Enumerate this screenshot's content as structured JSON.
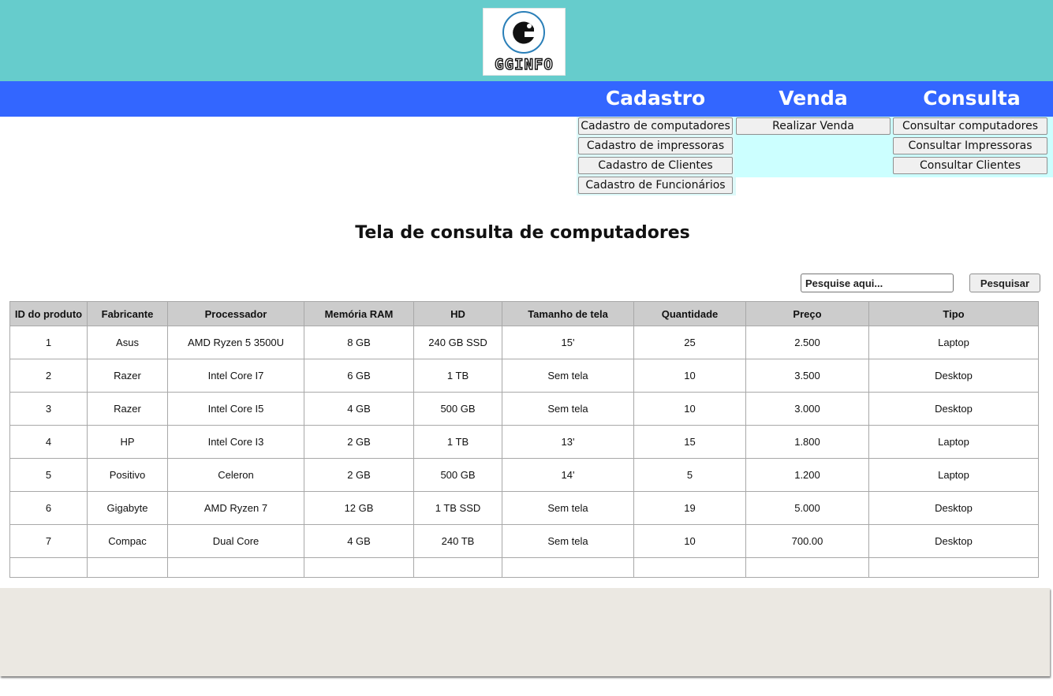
{
  "header": {
    "logo_text": "GGINFO",
    "bg_color": "#66cccc"
  },
  "nav": {
    "bg_color": "#3366ff",
    "menus": [
      {
        "title": "Cadastro",
        "items": [
          "Cadastro de computadores",
          "Cadastro de impressoras",
          "Cadastro de Clientes",
          "Cadastro de Funcionários"
        ]
      },
      {
        "title": "Venda",
        "items": [
          "Realizar Venda"
        ]
      },
      {
        "title": "Consulta",
        "items": [
          "Consultar computadores",
          "Consultar Impressoras",
          "Consultar Clientes"
        ]
      }
    ]
  },
  "page": {
    "title": "Tela de consulta de computadores"
  },
  "search": {
    "placeholder": "Pesquise aqui...",
    "value": "",
    "button_label": "Pesquisar"
  },
  "table": {
    "columns": [
      "ID do produto",
      "Fabricante",
      "Processador",
      "Memória RAM",
      "HD",
      "Tamanho de tela",
      "Quantidade",
      "Preço",
      "Tipo"
    ],
    "rows": [
      [
        "1",
        "Asus",
        "AMD Ryzen 5 3500U",
        "8 GB",
        "240 GB SSD",
        "15'",
        "25",
        "2.500",
        "Laptop"
      ],
      [
        "2",
        "Razer",
        "Intel Core I7",
        "6 GB",
        "1 TB",
        "Sem tela",
        "10",
        "3.500",
        "Desktop"
      ],
      [
        "3",
        "Razer",
        "Intel Core I5",
        "4 GB",
        "500 GB",
        "Sem tela",
        "10",
        "3.000",
        "Desktop"
      ],
      [
        "4",
        "HP",
        "Intel Core I3",
        "2 GB",
        "1 TB",
        "13'",
        "15",
        "1.800",
        "Laptop"
      ],
      [
        "5",
        "Positivo",
        "Celeron",
        "2 GB",
        "500 GB",
        "14'",
        "5",
        "1.200",
        "Laptop"
      ],
      [
        "6",
        "Gigabyte",
        "AMD Ryzen 7",
        "12 GB",
        "1 TB SSD",
        "Sem tela",
        "19",
        "5.000",
        "Desktop"
      ],
      [
        "7",
        "Compac",
        "Dual Core",
        "4 GB",
        "240 TB",
        "Sem tela",
        "10",
        "700.00",
        "Desktop"
      ],
      [
        "",
        "",
        "",
        "",
        "",
        "",
        "",
        "",
        ""
      ]
    ]
  }
}
